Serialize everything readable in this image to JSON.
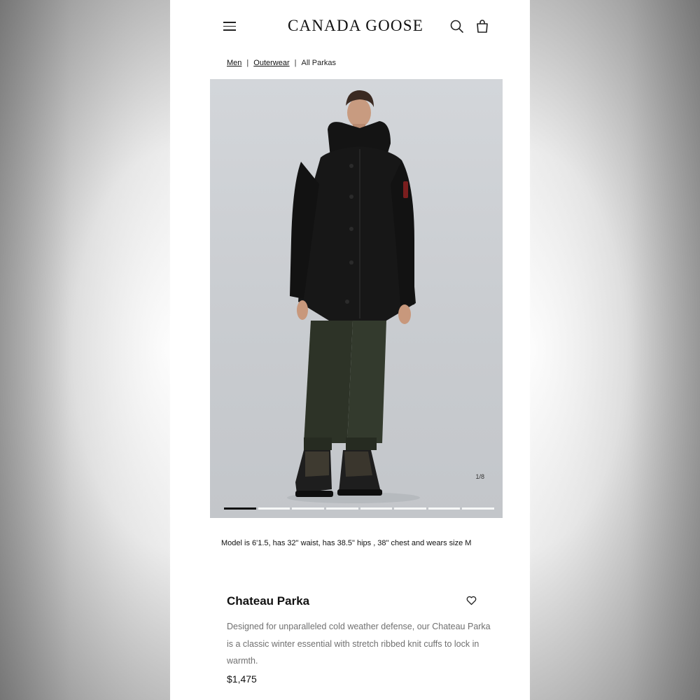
{
  "header": {
    "brand": "CANADA GOOSE",
    "menu_icon": "hamburger-menu-icon",
    "search_icon": "search-icon",
    "bag_icon": "shopping-bag-icon"
  },
  "breadcrumb": {
    "items": [
      "Men",
      "Outerwear",
      "All Parkas"
    ],
    "separator": "|"
  },
  "gallery": {
    "image_counter": "1/8",
    "current_index": 1,
    "total_images": 8
  },
  "model_info": "Model is 6'1.5, has 32\" waist, has 38.5\" hips , 38\" chest and wears size M",
  "product": {
    "name": "Chateau Parka",
    "description": "Designed for unparalleled cold weather defense, our Chateau Parka is a classic winter essential with stretch ribbed knit cuffs to lock in warmth.",
    "price": "$1,475",
    "wishlist_icon": "heart-icon"
  },
  "colors": {
    "text_primary": "#111111",
    "text_secondary": "#707070",
    "image_background": "#cfd2d6"
  }
}
